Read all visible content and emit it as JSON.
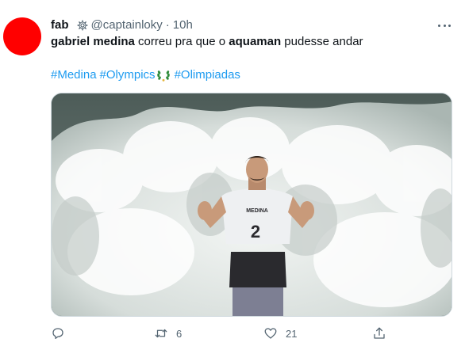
{
  "tweet": {
    "display_name": "fab",
    "handle": "@captainloky",
    "separator": "·",
    "time": "10h",
    "text_part1": "gabriel medina",
    "text_part2": " correu pra que o ",
    "text_part3": "aquaman",
    "text_part4": " pudesse andar",
    "hashtags": [
      "#Medina",
      "#Olympics",
      "#Olimpiadas"
    ],
    "media_bib_number": "2",
    "media_bib_label": "MEDINA"
  },
  "actions": {
    "reply_count": "",
    "retweet_count": "6",
    "like_count": "21"
  },
  "colors": {
    "avatar": "#ff0000",
    "link": "#1d9bf0",
    "secondary_text": "#536471"
  }
}
